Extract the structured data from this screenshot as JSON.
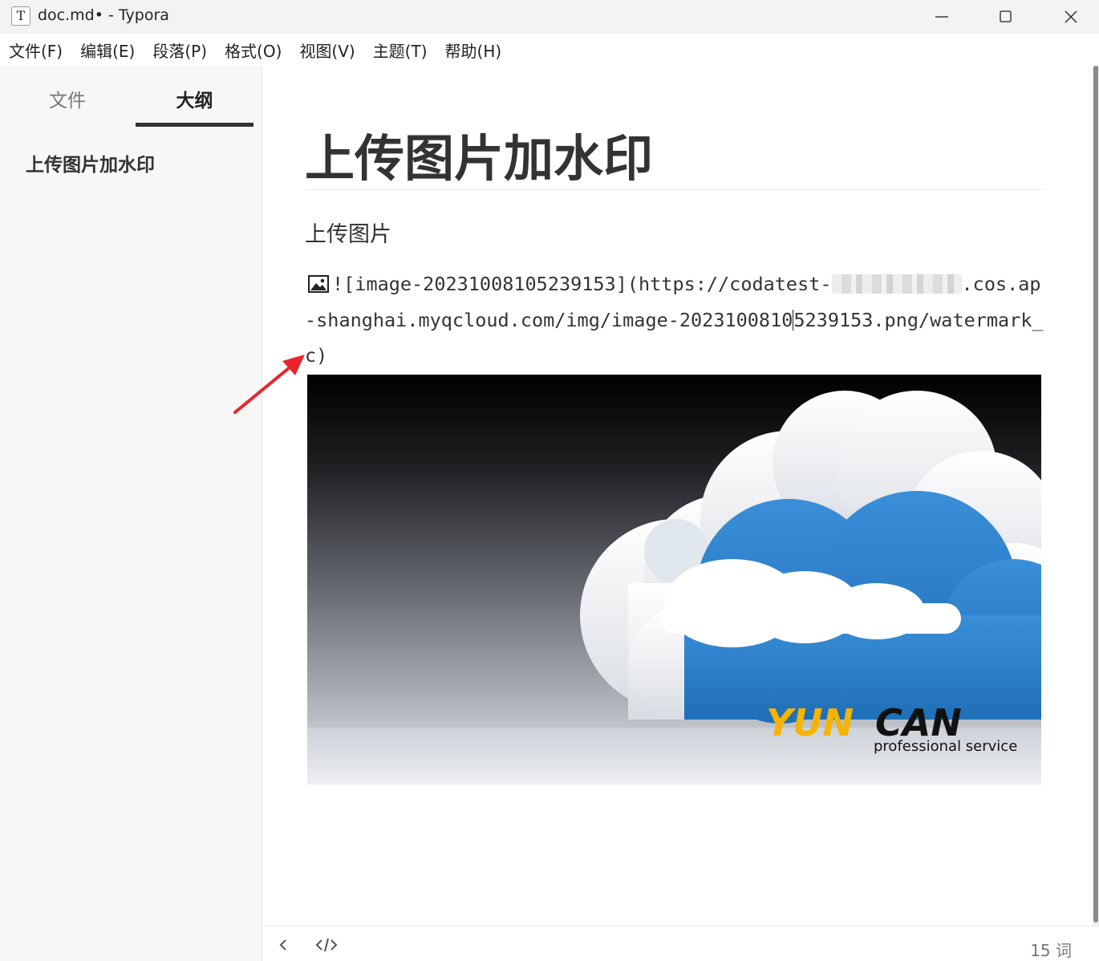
{
  "window": {
    "app_icon_glyph": "T",
    "title": "doc.md• - Typora",
    "controls": [
      "minimize-icon",
      "maximize-icon",
      "close-icon"
    ]
  },
  "menu": [
    "文件(F)",
    "编辑(E)",
    "段落(P)",
    "格式(O)",
    "视图(V)",
    "主题(T)",
    "帮助(H)"
  ],
  "sidebar": {
    "tabs": [
      {
        "label": "文件",
        "active": false
      },
      {
        "label": "大纲",
        "active": true
      }
    ],
    "outline": [
      "上传图片加水印"
    ]
  },
  "document": {
    "heading": "上传图片加水印",
    "paragraph": "上传图片",
    "image_src_before_blur": "![image-20231008105239153](https://codatest-",
    "image_src_after_blur": ".cos.ap-shanghai.myqcloud.com/img/image-2023100810",
    "image_src_after_caret": "5239153.png/watermark_c)"
  },
  "image": {
    "watermark_brand_part1": "YUN",
    "watermark_brand_part2": "CAN",
    "watermark_tagline": "professional service",
    "brand_yellow": "#f4b400",
    "cloud_blue": "#2a7fc9"
  },
  "status": {
    "word_count": "15 词"
  },
  "colors": {
    "annotation_arrow": "#e8252b",
    "sidebar_bg": "#f7f7f7"
  }
}
